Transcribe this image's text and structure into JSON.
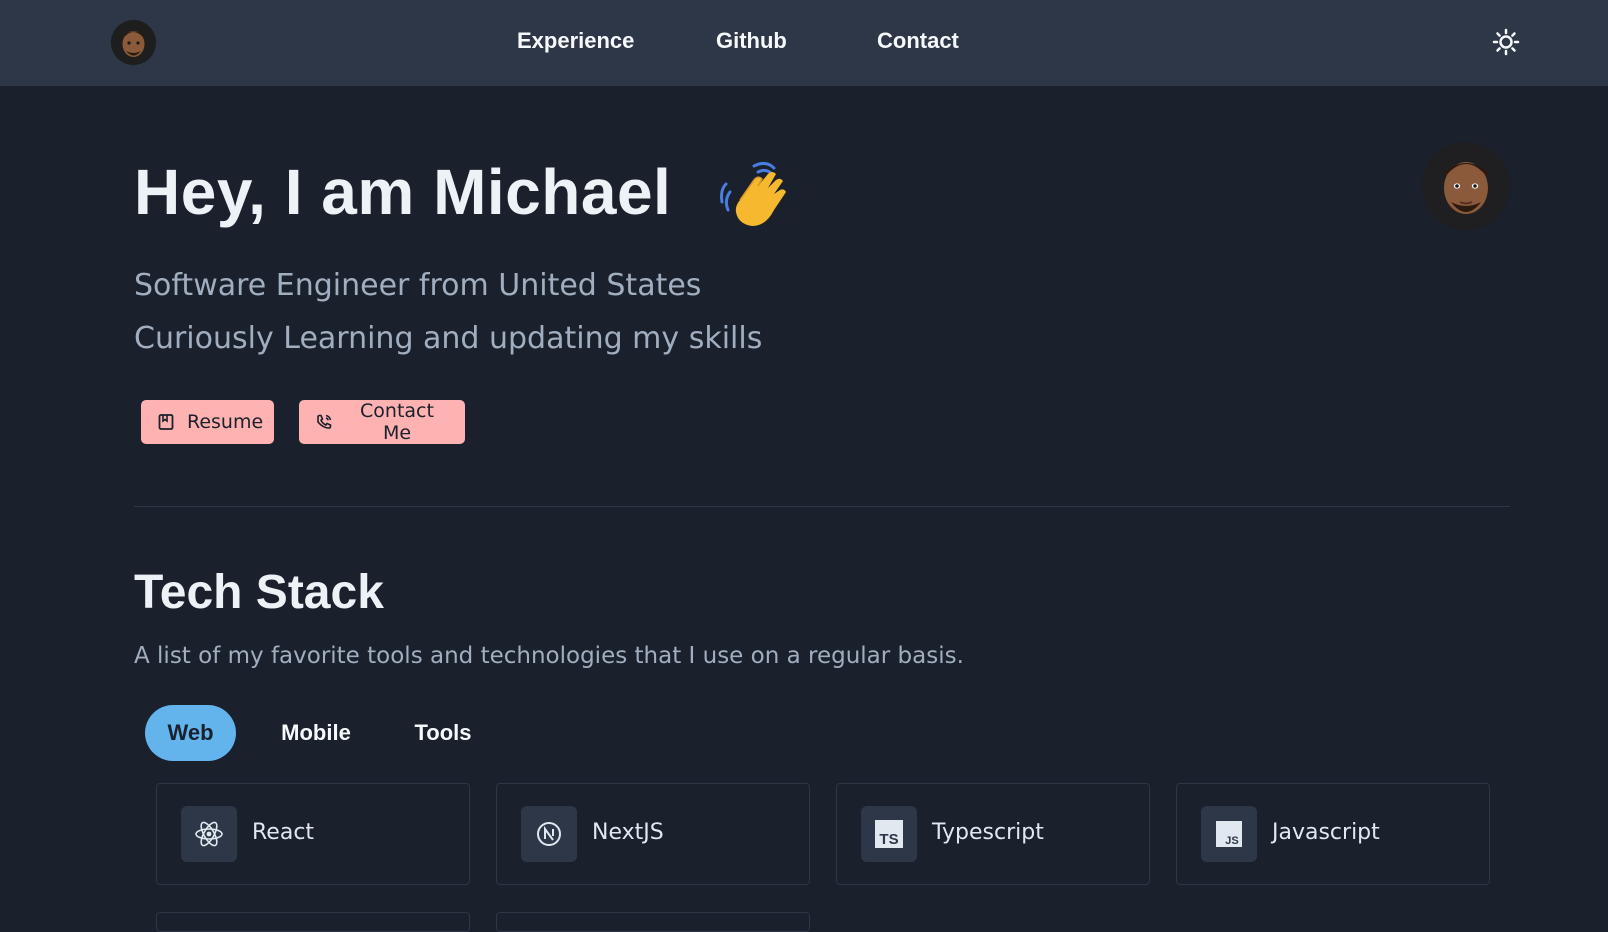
{
  "nav": {
    "links": [
      "Experience",
      "Github",
      "Contact"
    ],
    "avatar_icon": "memoji-avatar-icon",
    "theme_toggle_icon": "sun-icon"
  },
  "hero": {
    "title": "Hey, I am Michael",
    "wave_icon": "waving-hand-icon",
    "subtitle_1": "Software Engineer from United States",
    "subtitle_2": "Curiously Learning and updating my skills",
    "resume_label": "Resume",
    "contact_label": "Contact Me"
  },
  "tech": {
    "title": "Tech Stack",
    "description": "A list of my favorite tools and technologies that I use on a regular basis.",
    "tabs": [
      "Web",
      "Mobile",
      "Tools"
    ],
    "active_tab": "Web",
    "items": [
      {
        "label": "React",
        "icon": "react-icon"
      },
      {
        "label": "NextJS",
        "icon": "nextjs-icon"
      },
      {
        "label": "Typescript",
        "icon": "typescript-icon"
      },
      {
        "label": "Javascript",
        "icon": "javascript-icon"
      }
    ]
  },
  "colors": {
    "background": "#1a202c",
    "navbar": "#2d3748",
    "button": "#feb2b2",
    "active_tab": "#63b3ed",
    "muted_text": "#a0aec0"
  }
}
